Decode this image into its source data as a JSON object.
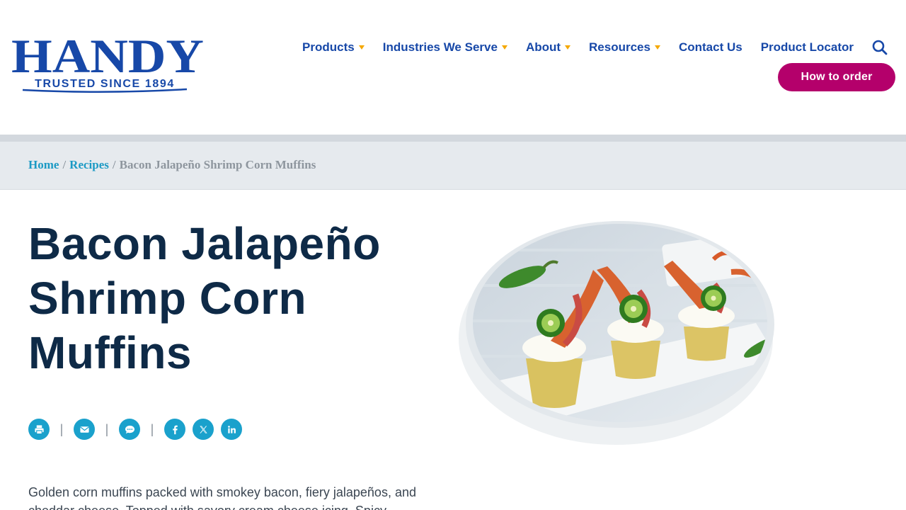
{
  "brand": {
    "name": "HANDY",
    "tagline": "TRUSTED SINCE 1894",
    "color": "#1748a8"
  },
  "nav": {
    "items": [
      {
        "label": "Products",
        "has_dropdown": true
      },
      {
        "label": "Industries We Serve",
        "has_dropdown": true
      },
      {
        "label": "About",
        "has_dropdown": true
      },
      {
        "label": "Resources",
        "has_dropdown": true
      },
      {
        "label": "Contact Us",
        "has_dropdown": false
      },
      {
        "label": "Product Locator",
        "has_dropdown": false
      }
    ],
    "search_icon": "search-icon",
    "cta_label": "How to order",
    "cta_color": "#b4006b",
    "caret_color": "#f5a800"
  },
  "breadcrumb": {
    "home": "Home",
    "recipes": "Recipes",
    "separator": "/",
    "current": "Bacon Jalapeño Shrimp Corn Muffins"
  },
  "recipe": {
    "title": "Bacon Jalapeño Shrimp Corn Muffins",
    "description": "Golden corn muffins packed with smokey bacon, fiery jalapeños, and cheddar cheese. Topped with savory cream cheese icing. Spicy"
  },
  "share": {
    "icons": [
      "print-icon",
      "email-icon",
      "sms-icon",
      "facebook-icon",
      "x-icon",
      "linkedin-icon"
    ],
    "separator": "|",
    "color": "#1aa1cc"
  }
}
